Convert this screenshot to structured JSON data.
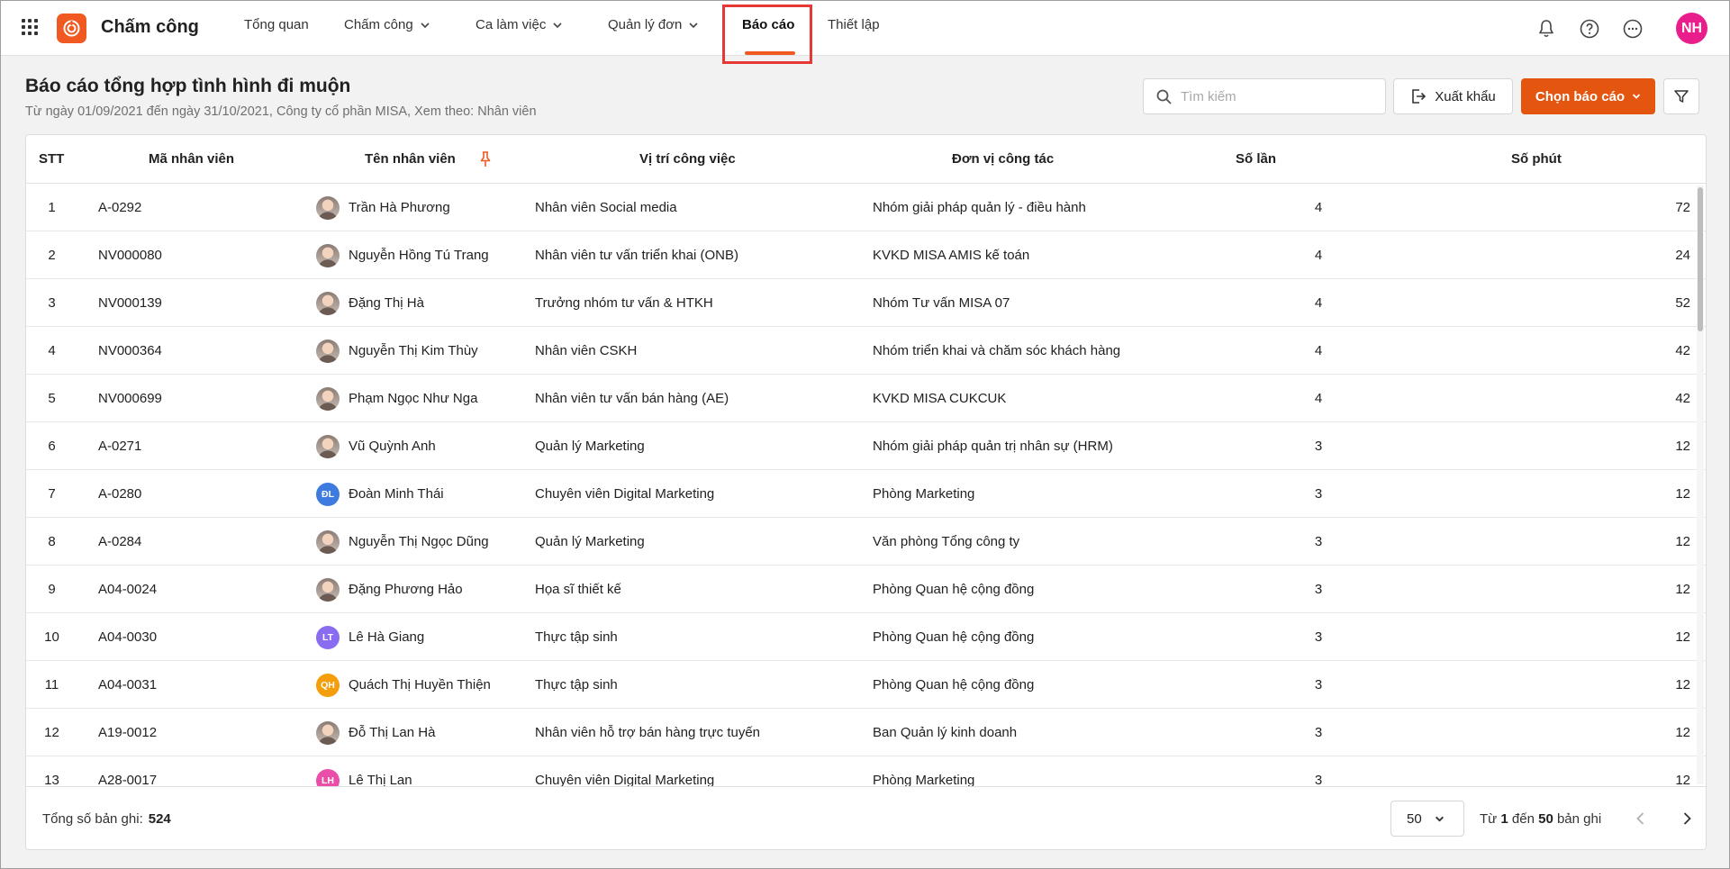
{
  "app": {
    "title": "Chấm công",
    "user_initials": "NH"
  },
  "nav": [
    {
      "label": "Tổng quan",
      "dropdown": false
    },
    {
      "label": "Chấm công",
      "dropdown": true
    },
    {
      "label": "Ca làm việc",
      "dropdown": true
    },
    {
      "label": "Quản lý đơn",
      "dropdown": true
    },
    {
      "label": "Báo cáo",
      "dropdown": false,
      "active": true
    },
    {
      "label": "Thiết lập",
      "dropdown": false
    }
  ],
  "header_icons": [
    "bell-icon",
    "help-icon",
    "more-icon"
  ],
  "page": {
    "title": "Báo cáo tổng hợp tình hình đi muộn",
    "subtitle": "Từ ngày 01/09/2021 đến ngày 31/10/2021, Công ty cổ phần MISA, Xem theo: Nhân viên"
  },
  "toolbar": {
    "search_placeholder": "Tìm kiếm",
    "export_label": "Xuất khẩu",
    "report_label": "Chọn báo cáo"
  },
  "table": {
    "columns": [
      "STT",
      "Mã nhân viên",
      "Tên nhân viên",
      "Vị trí công việc",
      "Đơn vị công tác",
      "Số lần",
      "Số phút"
    ],
    "rows": [
      {
        "stt": "1",
        "code": "A-0292",
        "name": "Trần Hà Phương",
        "avatar": "photo",
        "position": "Nhân viên Social media",
        "unit": "Nhóm giải pháp quản lý - điều hành",
        "count": "4",
        "minutes": "72"
      },
      {
        "stt": "2",
        "code": "NV000080",
        "name": "Nguyễn Hồng Tú Trang",
        "avatar": "photo",
        "position": "Nhân viên tư vấn triển khai (ONB)",
        "unit": "KVKD MISA AMIS kế toán",
        "count": "4",
        "minutes": "24"
      },
      {
        "stt": "3",
        "code": "NV000139",
        "name": "Đặng Thị Hà",
        "avatar": "photo",
        "position": "Trưởng nhóm tư vấn & HTKH",
        "unit": "Nhóm Tư vấn MISA 07",
        "count": "4",
        "minutes": "52"
      },
      {
        "stt": "4",
        "code": "NV000364",
        "name": "Nguyễn Thị Kim Thùy",
        "avatar": "photo",
        "position": "Nhân viên CSKH",
        "unit": "Nhóm triển khai và chăm sóc khách hàng",
        "count": "4",
        "minutes": "42"
      },
      {
        "stt": "5",
        "code": "NV000699",
        "name": "Phạm Ngọc Như Nga",
        "avatar": "photo",
        "position": "Nhân viên tư vấn bán hàng (AE)",
        "unit": "KVKD MISA CUKCUK",
        "count": "4",
        "minutes": "42"
      },
      {
        "stt": "6",
        "code": "A-0271",
        "name": "Vũ Quỳnh Anh",
        "avatar": "photo",
        "position": "Quản lý Marketing",
        "unit": "Nhóm giải pháp quản trị nhân sự (HRM)",
        "count": "3",
        "minutes": "12"
      },
      {
        "stt": "7",
        "code": "A-0280",
        "name": "Đoàn Minh Thái",
        "avatar": "ĐL",
        "avatar_color": "#3d7be0",
        "position": "Chuyên viên Digital Marketing",
        "unit": "Phòng Marketing",
        "count": "3",
        "minutes": "12"
      },
      {
        "stt": "8",
        "code": "A-0284",
        "name": "Nguyễn Thị Ngọc Dũng",
        "avatar": "photo",
        "position": "Quản lý Marketing",
        "unit": "Văn phòng Tổng công ty",
        "count": "3",
        "minutes": "12"
      },
      {
        "stt": "9",
        "code": "A04-0024",
        "name": "Đặng Phương Hảo",
        "avatar": "photo",
        "position": "Họa sĩ thiết kế",
        "unit": "Phòng Quan hệ cộng đồng",
        "count": "3",
        "minutes": "12"
      },
      {
        "stt": "10",
        "code": "A04-0030",
        "name": "Lê Hà Giang",
        "avatar": "LT",
        "avatar_color": "#8a6cf0",
        "position": "Thực tập sinh",
        "unit": "Phòng Quan hệ cộng đồng",
        "count": "3",
        "minutes": "12"
      },
      {
        "stt": "11",
        "code": "A04-0031",
        "name": "Quách Thị Huyền Thiện",
        "avatar": "QH",
        "avatar_color": "#f59e0b",
        "position": "Thực tập sinh",
        "unit": "Phòng Quan hệ cộng đồng",
        "count": "3",
        "minutes": "12"
      },
      {
        "stt": "12",
        "code": "A19-0012",
        "name": "Đỗ Thị Lan Hà",
        "avatar": "photo",
        "position": "Nhân viên hỗ trợ bán hàng trực tuyến",
        "unit": "Ban Quản lý kinh doanh",
        "count": "3",
        "minutes": "12"
      },
      {
        "stt": "13",
        "code": "A28-0017",
        "name": "Lê Thị Lan",
        "avatar": "LH",
        "avatar_color": "#e94fa8",
        "position": "Chuyên viên Digital Marketing",
        "unit": "Phòng Marketing",
        "count": "3",
        "minutes": "12"
      }
    ]
  },
  "footer": {
    "total_label": "Tổng số bản ghi:",
    "total_value": "524",
    "page_size": "50",
    "range_prefix": "Từ",
    "range_from": "1",
    "range_mid": "đến",
    "range_to": "50",
    "range_suffix": "bản ghi"
  },
  "colors": {
    "accent": "#f05a22",
    "button_primary": "#e4560f",
    "highlight_box": "#e53935",
    "avatar_main": "#e91e8c"
  }
}
